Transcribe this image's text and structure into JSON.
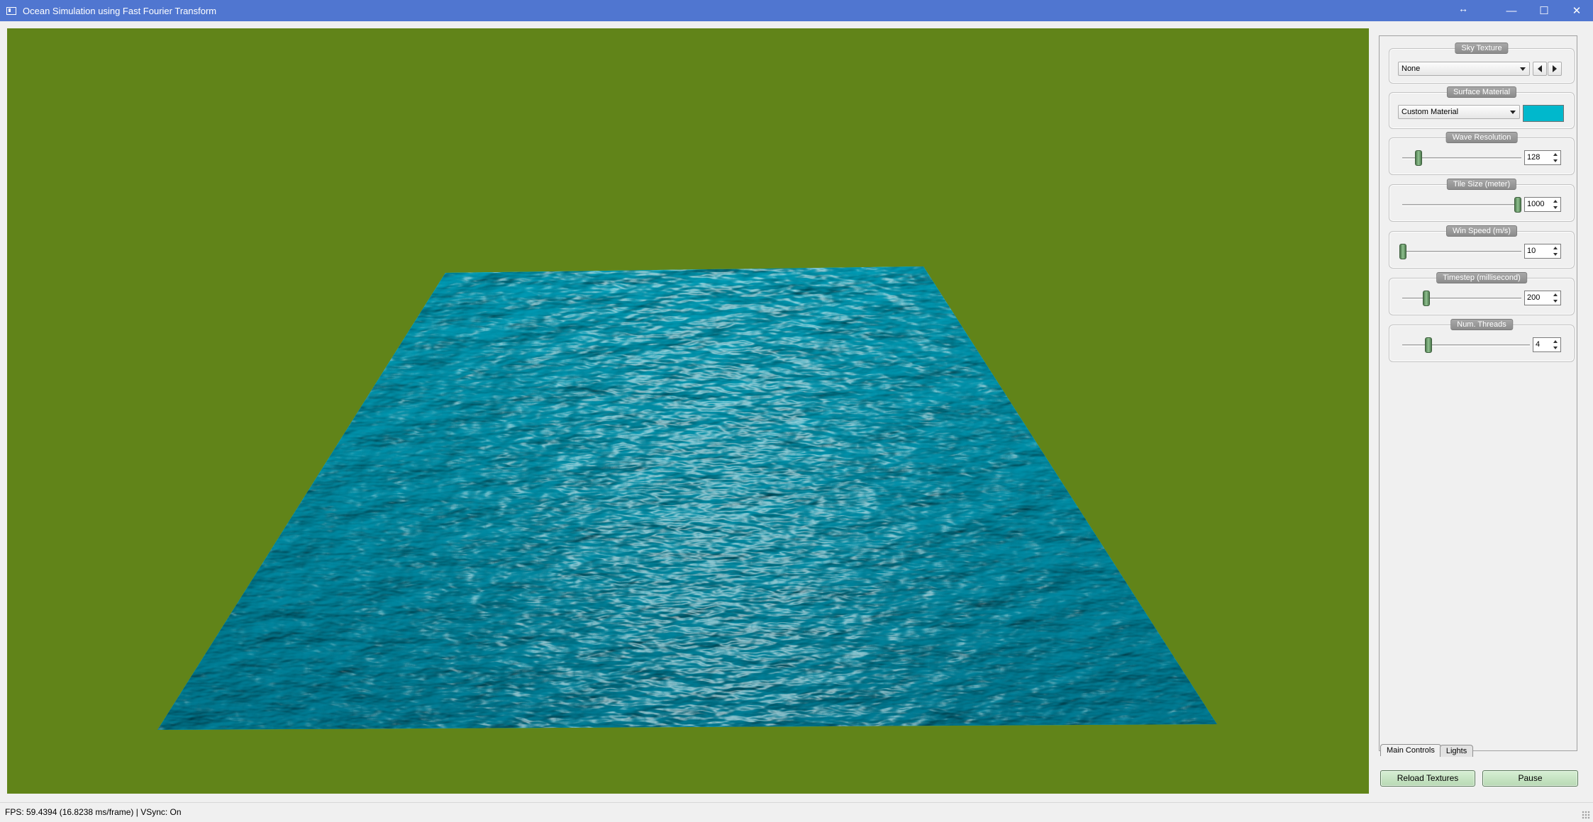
{
  "window": {
    "title": "Ocean Simulation using Fast Fourier Transform",
    "controls": {
      "minimize": "—",
      "maximize": "☐",
      "close": "✕",
      "resize_hint": "↔"
    }
  },
  "viewport": {
    "background_color": "#618419",
    "water_color": "#1bb8c8"
  },
  "panel": {
    "sky_texture": {
      "title": "Sky Texture",
      "selected": "None"
    },
    "surface_material": {
      "title": "Surface Material",
      "selected": "Custom Material",
      "color": "#00b8cc"
    },
    "wave_resolution": {
      "title": "Wave Resolution",
      "value": "128",
      "slider_fraction": 0.1
    },
    "tile_size": {
      "title": "Tile Size (meter)",
      "value": "1000",
      "slider_fraction": 1.0
    },
    "wind_speed": {
      "title": "Win Speed (m/s)",
      "value": "10",
      "slider_fraction": 0.0
    },
    "timestep": {
      "title": "Timestep (millisecond)",
      "value": "200",
      "slider_fraction": 0.2
    },
    "num_threads": {
      "title": "Num. Threads",
      "value": "4",
      "slider_fraction": 0.2
    }
  },
  "tabs": [
    {
      "label": "Main Controls",
      "active": true
    },
    {
      "label": "Lights",
      "active": false
    }
  ],
  "buttons": {
    "reload": "Reload Textures",
    "pause": "Pause"
  },
  "status": {
    "text": "FPS: 59.4394 (16.8238 ms/frame) | VSync: On"
  }
}
